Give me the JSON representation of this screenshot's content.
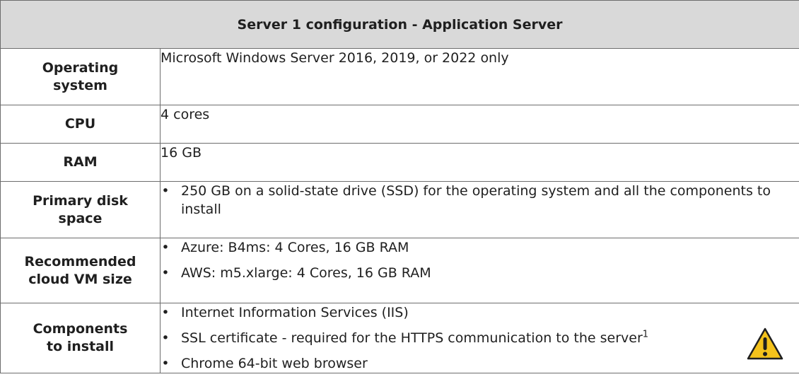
{
  "table": {
    "title": "Server 1 configuration - Application Server",
    "rows": {
      "os": {
        "label": "Operating system",
        "value": "Microsoft Windows Server 2016, 2019, or 2022 only"
      },
      "cpu": {
        "label": "CPU",
        "value": "4 cores"
      },
      "ram": {
        "label": "RAM",
        "value": "16 GB"
      },
      "disk": {
        "label": "Primary disk space",
        "items": [
          "250 GB on a solid-state drive (SSD) for the operating system and all the components to install"
        ]
      },
      "vm": {
        "label": "Recommended cloud VM size",
        "items": [
          "Azure: B4ms: 4 Cores, 16 GB RAM",
          "AWS: m5.xlarge: 4 Cores, 16 GB RAM"
        ]
      },
      "components": {
        "label": "Components to install",
        "items": [
          "Internet Information Services (IIS)",
          "SSL certificate - required for the HTTPS communication to the server",
          "Chrome 64-bit web browser"
        ],
        "footnote_mark": "1"
      }
    },
    "bullet": "•",
    "warning_icon": "warning-triangle-icon",
    "colors": {
      "header_bg": "#d9d9d9",
      "border": "#6d6d6d",
      "warning_fill": "#f4c21b"
    }
  }
}
